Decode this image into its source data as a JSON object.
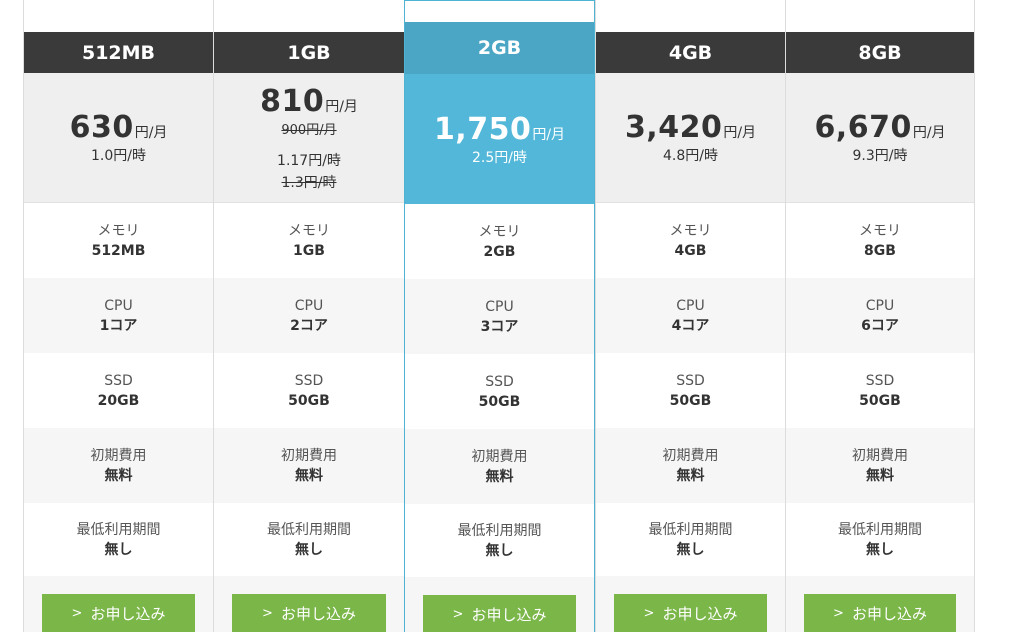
{
  "apply_label": "お申し込み",
  "spec_labels": {
    "memory": "メモリ",
    "cpu": "CPU",
    "ssd": "SSD",
    "initial_fee": "初期費用",
    "min_period": "最低利用期間"
  },
  "colors": {
    "header_dark": "#3a3a3a",
    "featured_header": "#4aa6c4",
    "featured_price": "#52b7d8",
    "apply_button": "#7ab648"
  },
  "plans": [
    {
      "name": "512MB",
      "price": "630",
      "price_unit": "円/月",
      "hourly": "1.0円/時",
      "memory": "512MB",
      "cpu": "1コア",
      "ssd": "20GB",
      "initial_fee": "無料",
      "min_period": "無し"
    },
    {
      "name": "1GB",
      "price": "810",
      "price_unit": "円/月",
      "price_old": "900円/月",
      "hourly": "1.17円/時",
      "hourly_old": "1.3円/時",
      "memory": "1GB",
      "cpu": "2コア",
      "ssd": "50GB",
      "initial_fee": "無料",
      "min_period": "無し"
    },
    {
      "name": "2GB",
      "featured": true,
      "price": "1,750",
      "price_unit": "円/月",
      "hourly": "2.5円/時",
      "memory": "2GB",
      "cpu": "3コア",
      "ssd": "50GB",
      "initial_fee": "無料",
      "min_period": "無し"
    },
    {
      "name": "4GB",
      "price": "3,420",
      "price_unit": "円/月",
      "hourly": "4.8円/時",
      "memory": "4GB",
      "cpu": "4コア",
      "ssd": "50GB",
      "initial_fee": "無料",
      "min_period": "無し"
    },
    {
      "name": "8GB",
      "price": "6,670",
      "price_unit": "円/月",
      "hourly": "9.3円/時",
      "memory": "8GB",
      "cpu": "6コア",
      "ssd": "50GB",
      "initial_fee": "無料",
      "min_period": "無し"
    }
  ]
}
